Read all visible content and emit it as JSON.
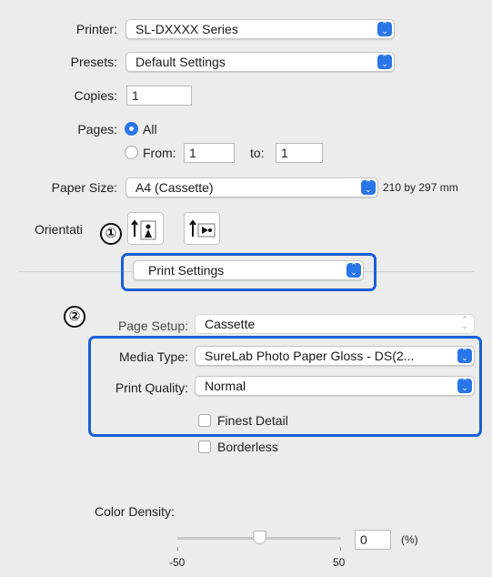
{
  "printer": {
    "label": "Printer:",
    "value": "SL-DXXXX Series"
  },
  "presets": {
    "label": "Presets:",
    "value": "Default Settings"
  },
  "copies": {
    "label": "Copies:",
    "value": "1"
  },
  "pages": {
    "label": "Pages:",
    "all_label": "All",
    "from_label": "From:",
    "from_value": "1",
    "to_label": "to:",
    "to_value": "1"
  },
  "paper_size": {
    "label": "Paper Size:",
    "value": "A4 (Cassette)",
    "dimensions": "210 by 297 mm"
  },
  "orientation": {
    "label": "Orientati"
  },
  "panel_selector": {
    "value": "Print Settings"
  },
  "callouts": {
    "one": "①",
    "two": "②"
  },
  "page_setup": {
    "label": "Page Setup:",
    "value": "Cassette"
  },
  "media_type": {
    "label": "Media Type:",
    "value": "SureLab Photo Paper Gloss - DS(2..."
  },
  "print_quality": {
    "label": "Print Quality:",
    "value": "Normal"
  },
  "finest_detail": {
    "label": "Finest Detail"
  },
  "borderless": {
    "label": "Borderless"
  },
  "color_density": {
    "label": "Color Density:",
    "value": "0",
    "unit": "(%)",
    "min_label": "-50",
    "max_label": "50",
    "slider_fraction": 0.5
  },
  "colors": {
    "accent": "#2a76e8",
    "callout": "#1a5fd6"
  }
}
